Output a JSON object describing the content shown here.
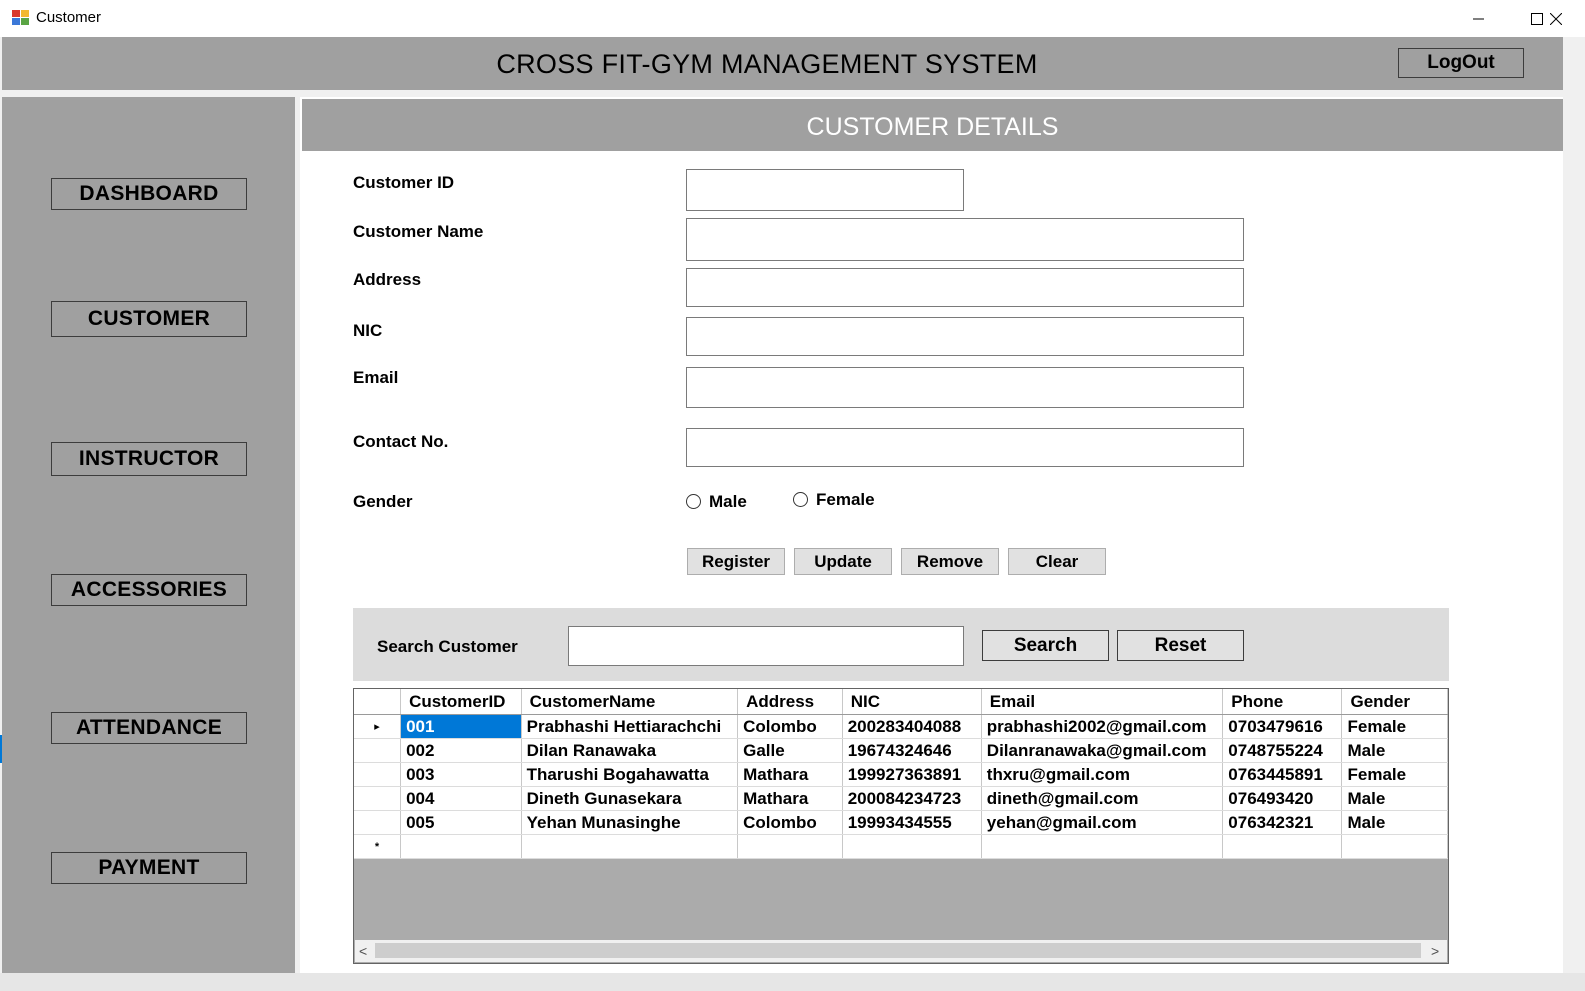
{
  "window": {
    "title": "Customer",
    "minimize_icon": "minimize-icon",
    "maximize_icon": "maximize-icon",
    "close_icon": "close-icon"
  },
  "header": {
    "title": "CROSS FIT-GYM MANAGEMENT SYSTEM",
    "logout_label": "LogOut"
  },
  "sidebar": {
    "items": [
      {
        "label": "DASHBOARD"
      },
      {
        "label": "CUSTOMER"
      },
      {
        "label": "INSTRUCTOR"
      },
      {
        "label": "ACCESSORIES"
      },
      {
        "label": "ATTENDANCE"
      },
      {
        "label": "PAYMENT"
      }
    ]
  },
  "main": {
    "section_title": "CUSTOMER DETAILS",
    "form": {
      "customer_id_label": "Customer ID",
      "customer_name_label": "Customer Name",
      "address_label": "Address",
      "nic_label": "NIC",
      "email_label": "Email",
      "contact_label": "Contact No.",
      "gender_label": "Gender",
      "gender_options": [
        "Male",
        "Female"
      ],
      "customer_id_value": "",
      "customer_name_value": "",
      "address_value": "",
      "nic_value": "",
      "email_value": "",
      "contact_value": ""
    },
    "actions": {
      "register": "Register",
      "update": "Update",
      "remove": "Remove",
      "clear": "Clear"
    },
    "search": {
      "label": "Search Customer",
      "value": "",
      "search_button": "Search",
      "reset_button": "Reset"
    },
    "grid": {
      "columns": [
        "CustomerID",
        "CustomerName",
        "Address",
        "NIC",
        "Email",
        "Phone",
        "Gender"
      ],
      "rows": [
        [
          "001",
          "Prabhashi Hettiarachchi",
          "Colombo",
          "200283404088",
          "prabhashi2002@gmail.com",
          "0703479616",
          "Female"
        ],
        [
          "002",
          "Dilan Ranawaka",
          "Galle",
          "19674324646",
          "Dilanranawaka@gmail.com",
          "0748755224",
          "Male"
        ],
        [
          "003",
          "Tharushi Bogahawatta",
          "Mathara",
          "199927363891",
          "thxru@gmail.com",
          "0763445891",
          "Female"
        ],
        [
          "004",
          "Dineth Gunasekara",
          "Mathara",
          "200084234723",
          "dineth@gmail.com",
          "076493420",
          "Male"
        ],
        [
          "005",
          "Yehan Munasinghe",
          "Colombo",
          "19993434555",
          "yehan@gmail.com",
          "076342321",
          "Male"
        ]
      ],
      "selected_row": 0,
      "current_row_marker": "▸",
      "new_row_marker": "*"
    },
    "scroll": {
      "left_arrow": "<",
      "right_arrow": ">"
    }
  }
}
